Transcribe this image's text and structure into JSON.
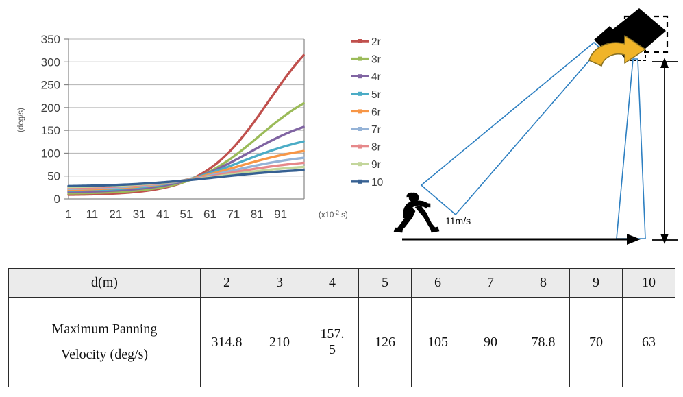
{
  "chart_data": {
    "type": "line",
    "title": "",
    "xlabel": "(x10-2 s)",
    "ylabel": "(deg/s)",
    "x_unit_label": "(x10",
    "x_unit_sup": "-2",
    "x_unit_tail": " s)",
    "y_unit_label": "(deg/s)",
    "xlim": [
      1,
      101
    ],
    "ylim": [
      0,
      350
    ],
    "ytick_labels": [
      "350",
      "300",
      "250",
      "200",
      "150",
      "100",
      "50",
      "0"
    ],
    "ytick_values": [
      350,
      300,
      250,
      200,
      150,
      100,
      50,
      0
    ],
    "xtick_labels": [
      "1",
      "11",
      "21",
      "31",
      "41",
      "51",
      "61",
      "71",
      "81",
      "91"
    ],
    "xtick_values": [
      1,
      11,
      21,
      31,
      41,
      51,
      61,
      71,
      81,
      91
    ],
    "grid": "horizontal",
    "legend_position": "right",
    "legend_truncated_last": true,
    "series": [
      {
        "name": "2r",
        "color": "#c0504d",
        "start": 9,
        "end": 316,
        "steep": 0.072,
        "mid": 86
      },
      {
        "name": "3r",
        "color": "#9bbb59",
        "start": 12,
        "end": 210,
        "steep": 0.068,
        "mid": 82
      },
      {
        "name": "4r",
        "color": "#8064a2",
        "start": 15,
        "end": 158,
        "steep": 0.064,
        "mid": 78
      },
      {
        "name": "5r",
        "color": "#4bacc6",
        "start": 18,
        "end": 126,
        "steep": 0.06,
        "mid": 75
      },
      {
        "name": "6r",
        "color": "#f79646",
        "start": 20,
        "end": 105,
        "steep": 0.058,
        "mid": 72
      },
      {
        "name": "7r",
        "color": "#95b3d7",
        "start": 22,
        "end": 90,
        "steep": 0.056,
        "mid": 70
      },
      {
        "name": "8r",
        "color": "#e6888a",
        "start": 24,
        "end": 79,
        "steep": 0.054,
        "mid": 68
      },
      {
        "name": "9r",
        "color": "#c3d69b",
        "start": 26,
        "end": 70,
        "steep": 0.053,
        "mid": 66
      },
      {
        "name": "10",
        "color": "#366092",
        "start": 28,
        "end": 63,
        "steep": 0.052,
        "mid": 64
      }
    ],
    "legend_entries": [
      "2r",
      "3r",
      "4r",
      "5r",
      "6r",
      "7r",
      "8r",
      "9r",
      "10"
    ]
  },
  "diagram": {
    "speed_label": "11m/s",
    "camera_name": "camera-icon",
    "runner_name": "running-person-icon",
    "rotation_arrow_name": "rotation-arrow-icon",
    "frustum_color": "#2d7fc1",
    "arrow_color": "#f0b429"
  },
  "table": {
    "header": [
      "d(m)",
      "2",
      "3",
      "4",
      "5",
      "6",
      "7",
      "8",
      "9",
      "10"
    ],
    "row_label_line1": "Maximum  Panning",
    "row_label_line2": "Velocity   (deg/s)",
    "values": [
      "314.8",
      "210",
      "157.\n5",
      "126",
      "105",
      "90",
      "78.8",
      "70",
      "63"
    ],
    "values_display": [
      "314.8",
      "210",
      "157. 5",
      "126",
      "105",
      "90",
      "78.8",
      "70",
      "63"
    ],
    "value_4_line1": "157.",
    "value_4_line2": "5"
  }
}
